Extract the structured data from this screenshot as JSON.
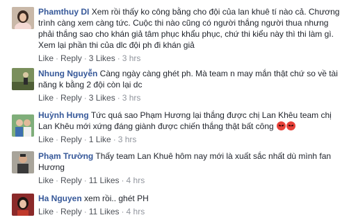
{
  "actions": {
    "like_label": "Like",
    "reply_label": "Reply",
    "separator": "·"
  },
  "comments": [
    {
      "author": "Phamthuy DI",
      "text": "Xem rồi thấy ko công bằng cho đội của lan khuê tí nào cả. Chương trình càng xem càng tức. Cuộc thi nào cũng có người thắng người thua nhưng phải thắng sao cho khán giả tâm phục khẩu phục, chứ thi kiểu này thì thi làm gì. Xem lại phần thi của dlc đội ph đi khán giả",
      "likes": "3 Likes",
      "time": "3 hrs",
      "avatar_icon": "avatar-woman-photo"
    },
    {
      "author": "Nhung Nguyễn",
      "text": "Càng ngày càng ghét ph. Mà team n may mắn thật chứ so về tài năng k bằng 2 đội còn lại dc",
      "likes": "3 Likes",
      "time": "3 hrs",
      "avatar_icon": "avatar-outdoor-photo"
    },
    {
      "author": "Huỳnh Hưng",
      "text": "Tức quá sao Phạm Hương lại thắng được chị Lan Khêu team chị Lan Khêu mới xứng đáng giành được chiến thắng thật bất công",
      "emoji": [
        "angry-face-icon",
        "angry-face-icon"
      ],
      "likes": "1 Like",
      "time": "3 hrs",
      "avatar_icon": "avatar-couple-photo"
    },
    {
      "author": "Phạm Trường",
      "text": "Thấy team Lan Khuê hôm nay mới là xuất sắc nhất dù mình fan Hương",
      "likes": "11 Likes",
      "time": "4 hrs",
      "avatar_icon": "avatar-man-photo"
    },
    {
      "author": "Ha Nguyen",
      "text": "xem rồi.. ghét PH",
      "likes": "11 Likes",
      "time": "4 hrs",
      "avatar_icon": "avatar-woman-red-photo"
    }
  ]
}
